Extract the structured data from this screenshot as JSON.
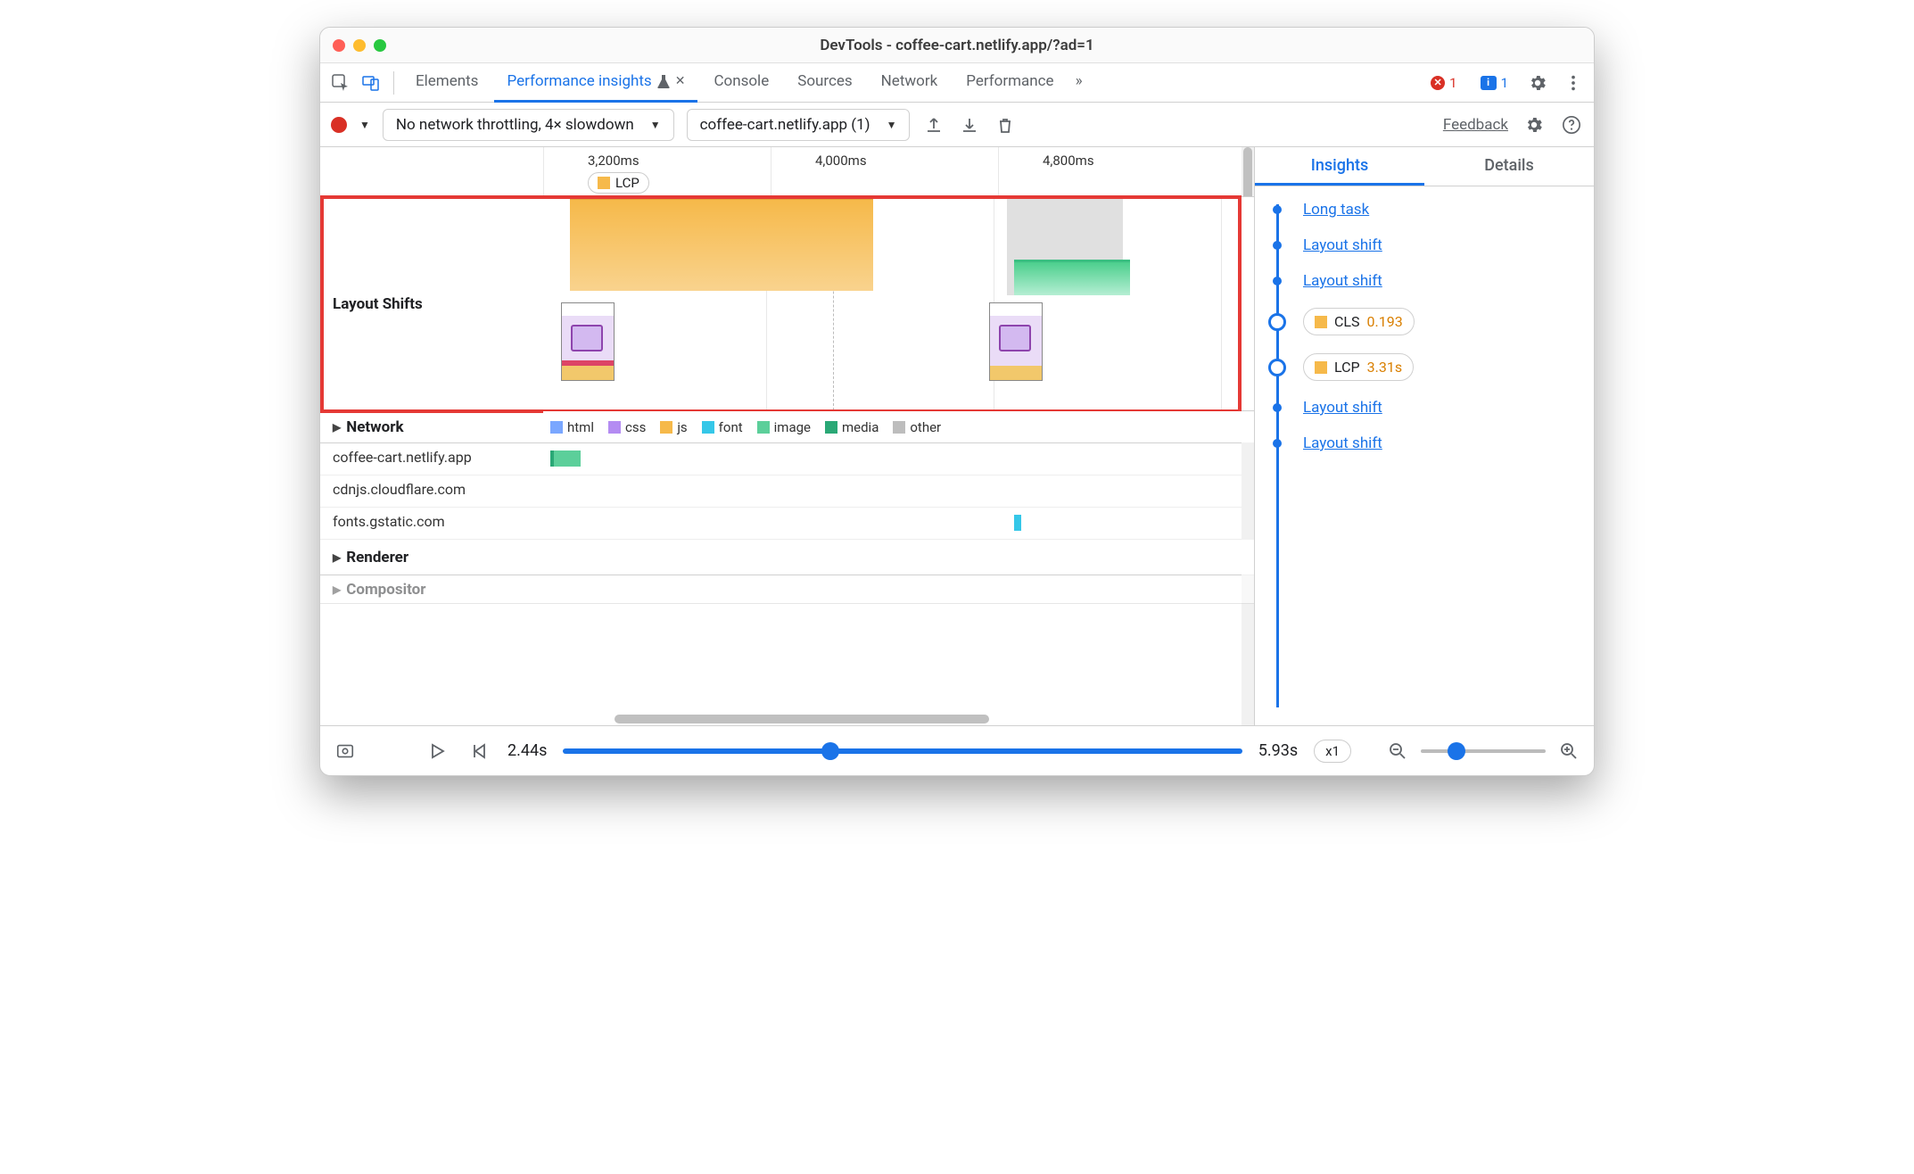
{
  "window": {
    "title": "DevTools - coffee-cart.netlify.app/?ad=1"
  },
  "tabs": {
    "elements": "Elements",
    "perf_insights": "Performance insights",
    "console": "Console",
    "sources": "Sources",
    "network": "Network",
    "performance": "Performance",
    "more": "»",
    "error_count": "1",
    "msg_count": "1"
  },
  "toolbar": {
    "throttle": "No network throttling, 4× slowdown",
    "recording": "coffee-cart.netlify.app (1)",
    "feedback": "Feedback"
  },
  "timeline": {
    "ticks": [
      "3,200ms",
      "4,000ms",
      "4,800ms"
    ],
    "lcp_label": "LCP",
    "layout_shifts": "Layout Shifts",
    "network": "Network",
    "renderer": "Renderer",
    "compositor": "Compositor",
    "legend": {
      "html": "html",
      "css": "css",
      "js": "js",
      "font": "font",
      "image": "image",
      "media": "media",
      "other": "other"
    },
    "hosts": [
      "coffee-cart.netlify.app",
      "cdnjs.cloudflare.com",
      "fonts.gstatic.com"
    ]
  },
  "insights": {
    "tab_insights": "Insights",
    "tab_details": "Details",
    "items": [
      {
        "type": "link",
        "label": "Long task"
      },
      {
        "type": "link",
        "label": "Layout shift"
      },
      {
        "type": "link",
        "label": "Layout shift"
      },
      {
        "type": "pill",
        "metric": "CLS",
        "value": "0.193",
        "color": "#f6b94a"
      },
      {
        "type": "pill",
        "metric": "LCP",
        "value": "3.31s",
        "color": "#f6b94a"
      },
      {
        "type": "link",
        "label": "Layout shift"
      },
      {
        "type": "link",
        "label": "Layout shift"
      }
    ]
  },
  "footer": {
    "start": "2.44s",
    "end": "5.93s",
    "speed": "x1"
  },
  "colors": {
    "html": "#7aa7ff",
    "css": "#b48cf2",
    "js": "#f6b94a",
    "font": "#35c7e8",
    "image": "#5ccf9a",
    "media": "#2aa876",
    "other": "#bdbdbd",
    "accent": "#1a73e8",
    "error": "#d93025"
  }
}
